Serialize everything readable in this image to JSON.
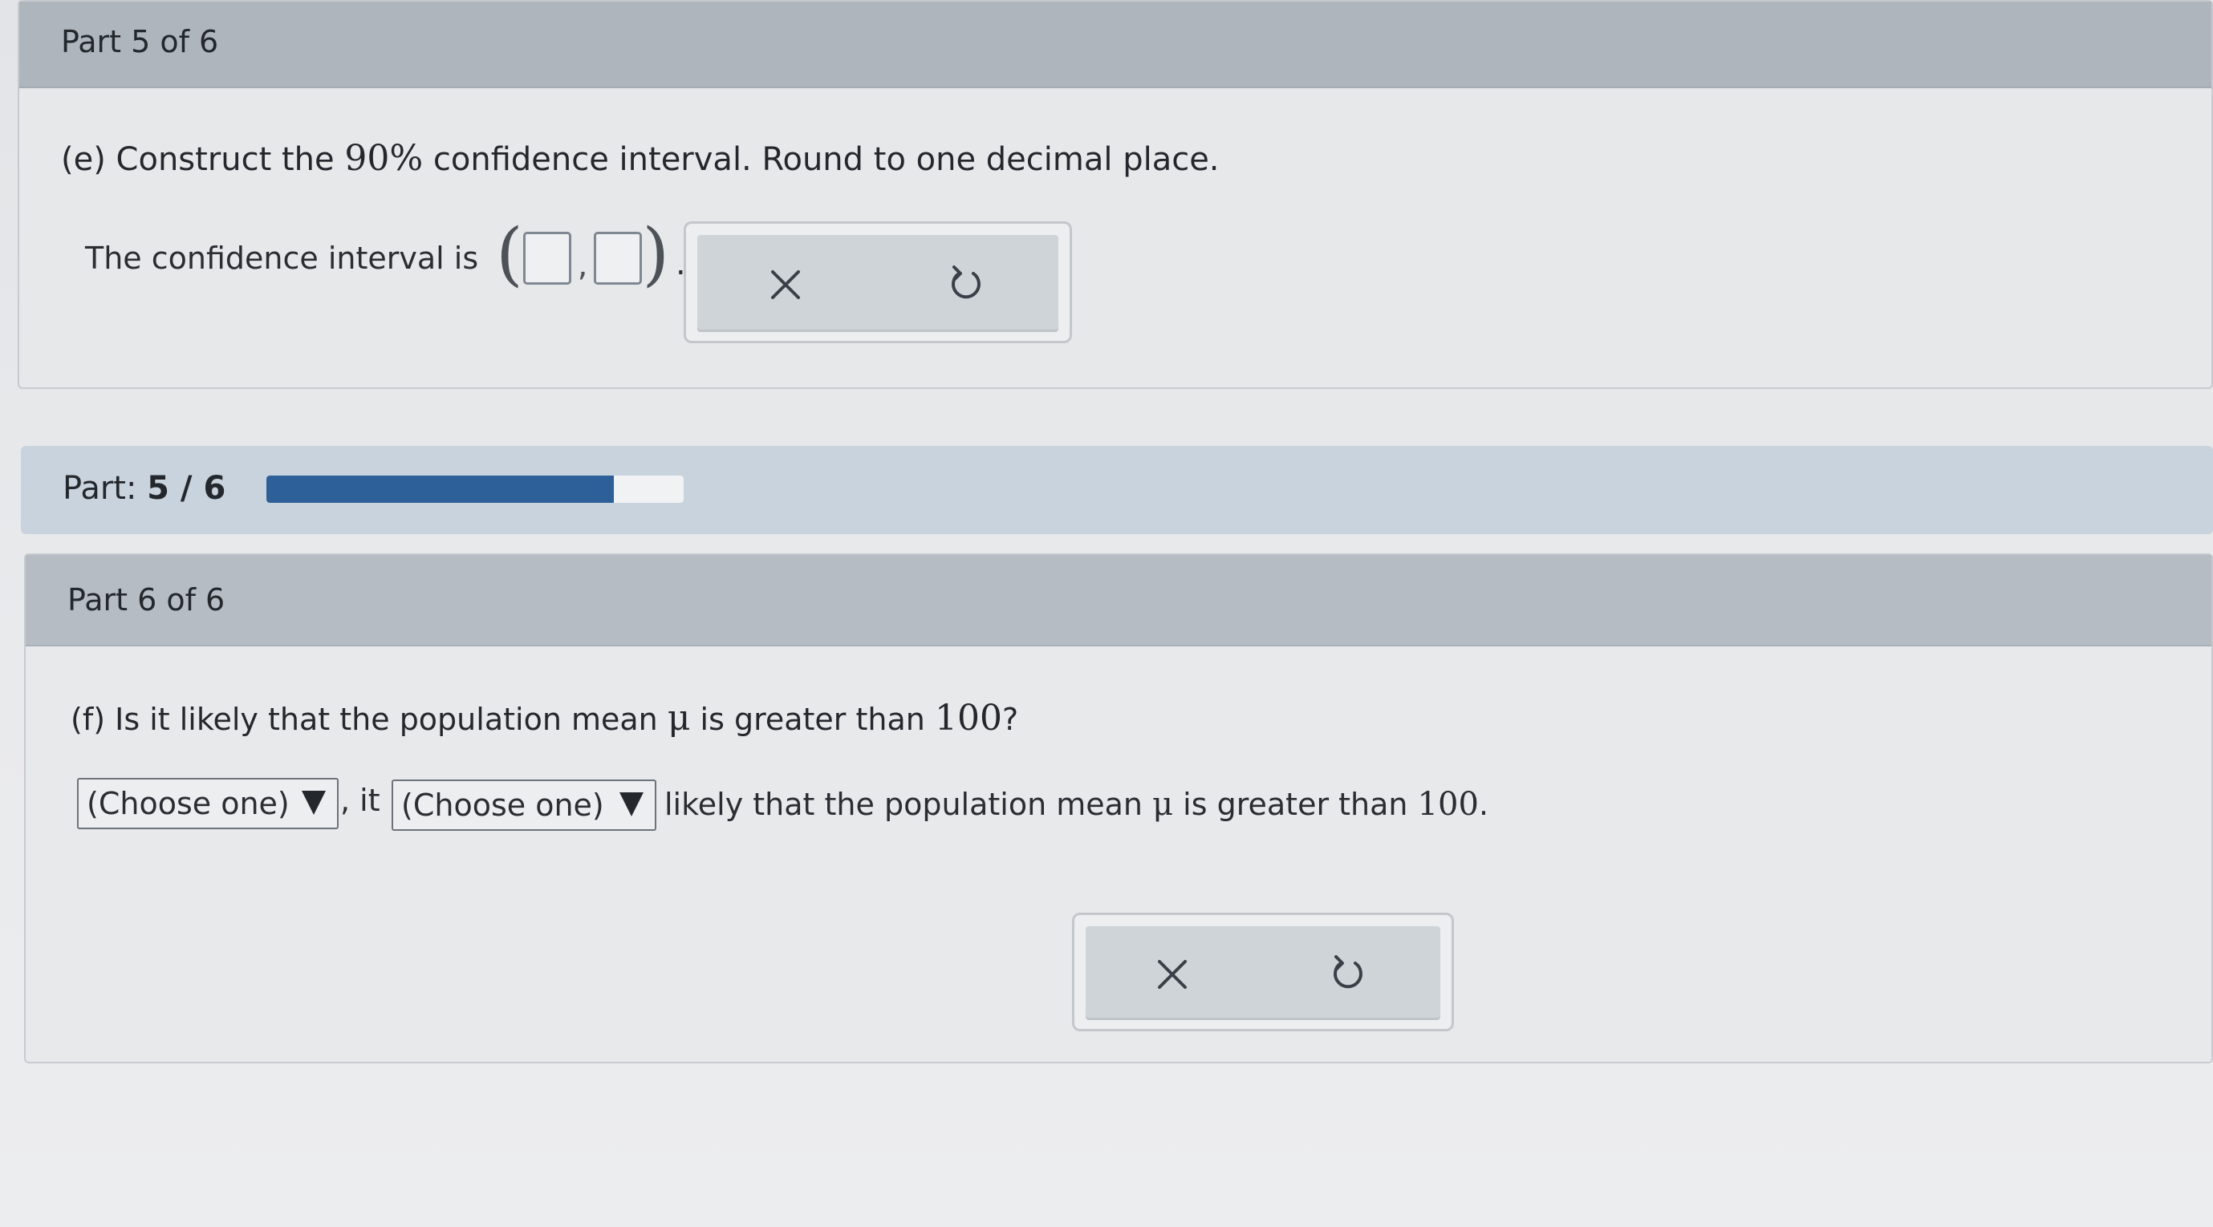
{
  "part5": {
    "header": "Part 5 of 6",
    "question_prefix": "(e) Construct the ",
    "question_math": "90%",
    "question_suffix": " confidence interval. Round to one decimal place.",
    "answer_prefix": "The confidence interval is",
    "open_paren": "(",
    "comma": ",",
    "close_paren": ")",
    "period": ".",
    "lower_value": "",
    "upper_value": ""
  },
  "progress": {
    "label": "Part:",
    "value_text": "5 / 6",
    "fraction": 0.8333
  },
  "part6": {
    "header": "Part 6 of 6",
    "question_prefix": "(f) Is it likely that the population mean ",
    "question_mu": "μ",
    "question_middle": " is greater than ",
    "question_num": "100",
    "question_suffix": "?",
    "select1_value": "(Choose one)",
    "connector": ", it",
    "select2_value": "(Choose one)",
    "sentence_prefix": "likely that the population mean ",
    "sentence_mu": "μ",
    "sentence_middle": " is greater than ",
    "sentence_num": "100",
    "sentence_suffix": "."
  },
  "icons": {
    "clear": "close-icon",
    "undo": "undo-icon"
  },
  "colors": {
    "header_bg": "#aeb5bd",
    "progress_fill": "#2d5f99",
    "progress_band": "#c9d3de"
  }
}
